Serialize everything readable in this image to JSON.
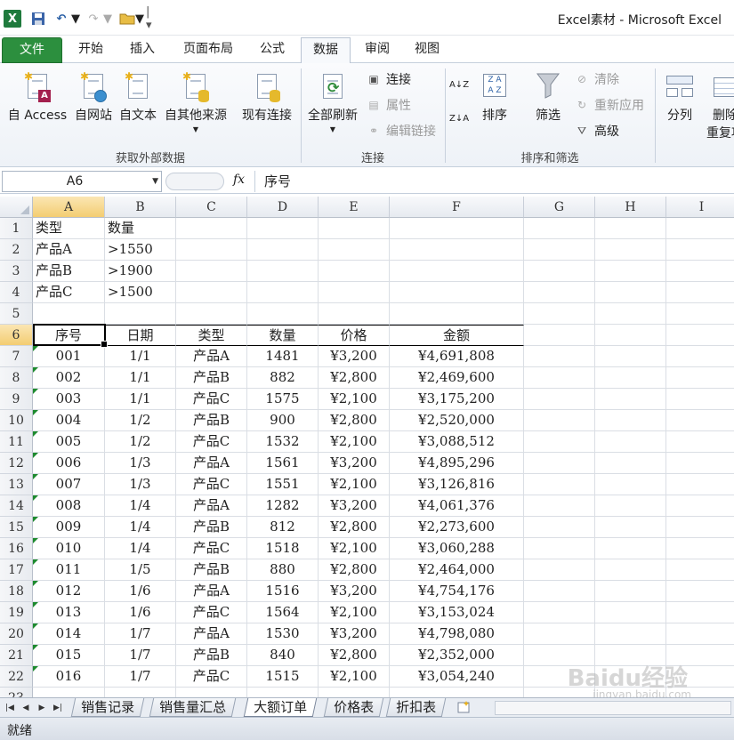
{
  "window": {
    "title": "Excel素材 - Microsoft Excel"
  },
  "ribbon_tabs": [
    "文件",
    "开始",
    "插入",
    "页面布局",
    "公式",
    "数据",
    "审阅",
    "视图"
  ],
  "active_tab": "数据",
  "ribbon": {
    "from_access": "自 Access",
    "from_web": "自网站",
    "from_text": "自文本",
    "from_other": "自其他来源",
    "existing_connections": "现有连接",
    "group_external": "获取外部数据",
    "refresh_all": "全部刷新",
    "connections": "连接",
    "properties": "属性",
    "edit_links": "编辑链接",
    "group_connections": "连接",
    "sort": "排序",
    "filter": "筛选",
    "clear": "清除",
    "reapply": "重新应用",
    "advanced": "高级",
    "group_sort_filter": "排序和筛选",
    "text_to_columns": "分列",
    "remove_duplicates_1": "删除",
    "remove_duplicates_2": "重复项"
  },
  "formula_bar": {
    "name_box": "A6",
    "fx": "fx",
    "content": "序号"
  },
  "columns": [
    "A",
    "B",
    "C",
    "D",
    "E",
    "F",
    "G",
    "H",
    "I"
  ],
  "criteria": [
    [
      "类型",
      "数量"
    ],
    [
      "产品A",
      ">1550"
    ],
    [
      "产品B",
      ">1900"
    ],
    [
      "产品C",
      ">1500"
    ]
  ],
  "table_headers": [
    "序号",
    "日期",
    "类型",
    "数量",
    "价格",
    "金额"
  ],
  "table_rows": [
    [
      "001",
      "1/1",
      "产品A",
      "1481",
      "¥3,200",
      "¥4,691,808"
    ],
    [
      "002",
      "1/1",
      "产品B",
      "882",
      "¥2,800",
      "¥2,469,600"
    ],
    [
      "003",
      "1/1",
      "产品C",
      "1575",
      "¥2,100",
      "¥3,175,200"
    ],
    [
      "004",
      "1/2",
      "产品B",
      "900",
      "¥2,800",
      "¥2,520,000"
    ],
    [
      "005",
      "1/2",
      "产品C",
      "1532",
      "¥2,100",
      "¥3,088,512"
    ],
    [
      "006",
      "1/3",
      "产品A",
      "1561",
      "¥3,200",
      "¥4,895,296"
    ],
    [
      "007",
      "1/3",
      "产品C",
      "1551",
      "¥2,100",
      "¥3,126,816"
    ],
    [
      "008",
      "1/4",
      "产品A",
      "1282",
      "¥3,200",
      "¥4,061,376"
    ],
    [
      "009",
      "1/4",
      "产品B",
      "812",
      "¥2,800",
      "¥2,273,600"
    ],
    [
      "010",
      "1/4",
      "产品C",
      "1518",
      "¥2,100",
      "¥3,060,288"
    ],
    [
      "011",
      "1/5",
      "产品B",
      "880",
      "¥2,800",
      "¥2,464,000"
    ],
    [
      "012",
      "1/6",
      "产品A",
      "1516",
      "¥3,200",
      "¥4,754,176"
    ],
    [
      "013",
      "1/6",
      "产品C",
      "1564",
      "¥2,100",
      "¥3,153,024"
    ],
    [
      "014",
      "1/7",
      "产品A",
      "1530",
      "¥3,200",
      "¥4,798,080"
    ],
    [
      "015",
      "1/7",
      "产品B",
      "840",
      "¥2,800",
      "¥2,352,000"
    ],
    [
      "016",
      "1/7",
      "产品C",
      "1515",
      "¥2,100",
      "¥3,054,240"
    ]
  ],
  "sheet_tabs": [
    "销售记录",
    "销售量汇总",
    "大额订单",
    "价格表",
    "折扣表"
  ],
  "active_sheet": "大额订单",
  "status": "就绪",
  "watermark": {
    "main": "Baidu经验",
    "sub": "jingyan.baidu.com"
  },
  "colors": {
    "file_tab": "#2c8f3e",
    "selection_header": "#f3cd72",
    "green_triangle": "#1d8a2e"
  }
}
